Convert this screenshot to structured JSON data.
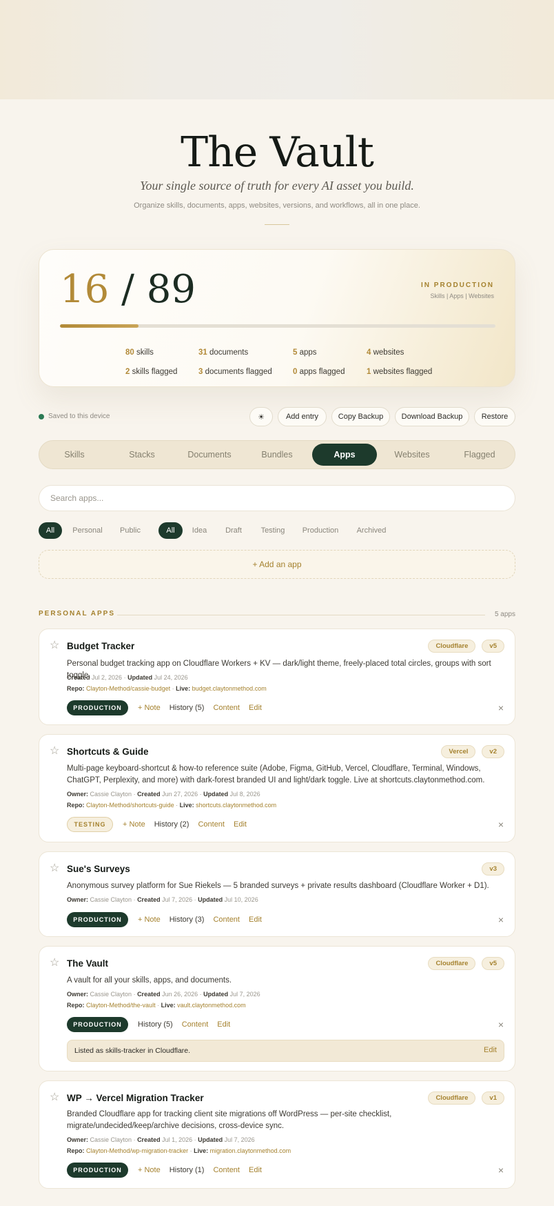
{
  "hero": {
    "title": "The Vault",
    "tagline": "Your single source of truth for every AI asset you build.",
    "subtitle": "Organize skills, documents, apps, websites, versions, and workflows, all in one place."
  },
  "stats": {
    "in_production": "16",
    "separator": "/",
    "total": "89",
    "progress_fraction": 0.18,
    "label": "IN PRODUCTION",
    "sublabel": "Skills | Apps | Websites",
    "row1": [
      {
        "num": "80",
        "label": "skills"
      },
      {
        "num": "31",
        "label": "documents"
      },
      {
        "num": "5",
        "label": "apps"
      },
      {
        "num": "4",
        "label": "websites"
      }
    ],
    "row2": [
      {
        "num": "2",
        "label": "skills flagged"
      },
      {
        "num": "3",
        "label": "documents flagged"
      },
      {
        "num": "0",
        "label": "apps flagged"
      },
      {
        "num": "1",
        "label": "websites flagged"
      }
    ]
  },
  "toolbar": {
    "saved": "Saved to this device",
    "theme_icon": "☀",
    "add_entry": "Add entry",
    "copy_backup": "Copy Backup",
    "download_backup": "Download Backup",
    "restore": "Restore"
  },
  "tabs": [
    "Skills",
    "Stacks",
    "Documents",
    "Bundles",
    "Apps",
    "Websites",
    "Flagged"
  ],
  "active_tab": "Apps",
  "search": {
    "placeholder": "Search apps..."
  },
  "filters": {
    "visibility": [
      "All",
      "Personal",
      "Public"
    ],
    "stage": [
      "All",
      "Idea",
      "Draft",
      "Testing",
      "Production",
      "Archived"
    ]
  },
  "add_app": "+ Add an app",
  "section": {
    "label": "PERSONAL APPS",
    "count": "5 apps"
  },
  "labels": {
    "owner": "Owner:",
    "created": "Created",
    "updated": "Updated",
    "repo": "Repo:",
    "live": "Live:",
    "note": "+ Note",
    "content": "Content",
    "edit": "Edit",
    "close": "×",
    "star": "☆"
  },
  "apps": [
    {
      "title": "Budget Tracker",
      "badges": [
        "Cloudflare",
        "v5"
      ],
      "description": "Personal budget tracking app on Cloudflare Workers + KV — dark/light theme, freely-placed total circles, groups with sort toggle.",
      "created": "Jul 2, 2026",
      "updated": "Jul 24, 2026",
      "repo": "Clayton-Method/cassie-budget",
      "live": "budget.claytonmethod.com",
      "status": "PRODUCTION",
      "history": "History (5)"
    },
    {
      "title": "Shortcuts & Guide",
      "badges": [
        "Vercel",
        "v2"
      ],
      "description": "Multi-page keyboard-shortcut & how-to reference suite (Adobe, Figma, GitHub, Vercel, Cloudflare, Terminal, Windows, ChatGPT, Perplexity, and more) with dark-forest branded UI and light/dark toggle. Live at shortcuts.claytonmethod.com.",
      "owner": "Cassie Clayton",
      "created": "Jun 27, 2026",
      "updated": "Jul 8, 2026",
      "repo": "Clayton-Method/shortcuts-guide",
      "live": "shortcuts.claytonmethod.com",
      "status": "TESTING",
      "history": "History (2)"
    },
    {
      "title": "Sue's Surveys",
      "badges": [
        "v3"
      ],
      "description": "Anonymous survey platform for Sue Riekels — 5 branded surveys + private results dashboard (Cloudflare Worker + D1).",
      "owner": "Cassie Clayton",
      "created": "Jul 7, 2026",
      "updated": "Jul 10, 2026",
      "status": "PRODUCTION",
      "history": "History (3)"
    },
    {
      "title": "The Vault",
      "badges": [
        "Cloudflare",
        "v5"
      ],
      "description": "A vault for all your skills, apps, and documents.",
      "owner": "Cassie Clayton",
      "created": "Jun 26, 2026",
      "updated": "Jul 7, 2026",
      "repo": "Clayton-Method/the-vault",
      "live": "vault.claytonmethod.com",
      "status": "PRODUCTION",
      "history": "History (5)",
      "note": "Listed as skills-tracker in Cloudflare."
    },
    {
      "title": "WP → Vercel Migration Tracker",
      "badges": [
        "Cloudflare",
        "v1"
      ],
      "description": "Branded Cloudflare app for tracking client site migrations off WordPress — per-site checklist, migrate/undecided/keep/archive decisions, cross-device sync.",
      "owner": "Cassie Clayton",
      "created": "Jul 1, 2026",
      "updated": "Jul 7, 2026",
      "repo": "Clayton-Method/wp-migration-tracker",
      "live": "migration.claytonmethod.com",
      "status": "PRODUCTION",
      "history": "History (1)"
    }
  ]
}
